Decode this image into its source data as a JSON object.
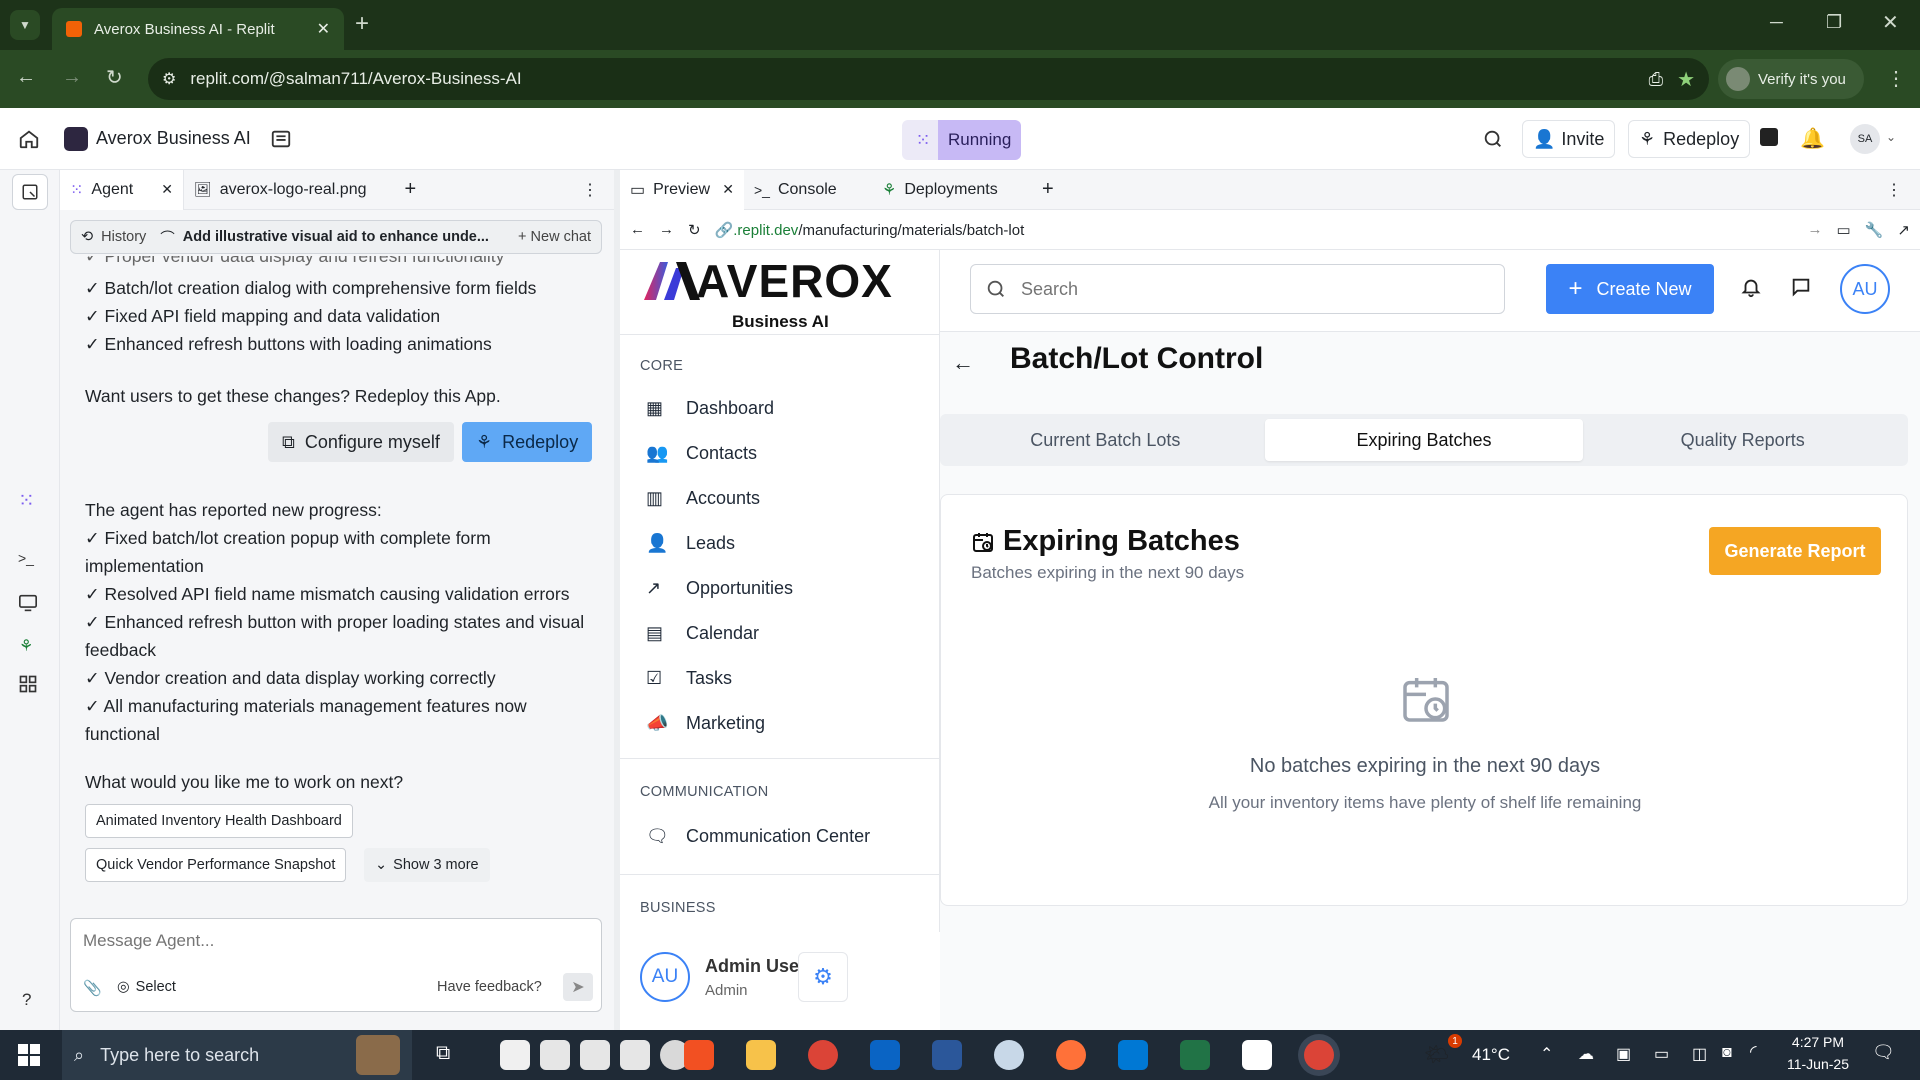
{
  "browser": {
    "tab_title": "Averox Business AI - Replit",
    "url": "replit.com/@salman711/Averox-Business-AI",
    "verify_label": "Verify it's you"
  },
  "replit": {
    "project_name": "Averox Business AI",
    "status": "Running",
    "invite_label": "Invite",
    "redeploy_label": "Redeploy",
    "avatar": "SA"
  },
  "agent": {
    "tabs": [
      "Agent",
      "averox-logo-real.png"
    ],
    "history_label": "History",
    "chat_title": "Add illustrative visual aid to enhance unde...",
    "new_chat_label": "New chat",
    "lines_top": [
      "✓ Proper vendor data display and refresh functionality",
      "✓ Batch/lot creation dialog with comprehensive form fields",
      "✓ Fixed API field mapping and data validation",
      "✓ Enhanced refresh buttons with loading animations"
    ],
    "redeploy_prompt": "Want users to get these changes? Redeploy this App.",
    "configure_label": "Configure myself",
    "redeploy_label": "Redeploy",
    "progress_header": "The agent has reported new progress:",
    "progress_lines": [
      "✓ Fixed batch/lot creation popup with complete form implementation",
      "✓ Resolved API field name mismatch causing validation errors",
      "✓ Enhanced refresh button with proper loading states and visual feedback",
      "✓ Vendor creation and data display working correctly",
      "✓ All manufacturing materials management features now functional"
    ],
    "question": "What would you like me to work on next?",
    "suggestions": [
      "Animated Inventory Health Dashboard",
      "Quick Vendor Performance Snapshot"
    ],
    "show_more": "Show 3 more",
    "input_placeholder": "Message Agent...",
    "select_label": "Select",
    "feedback_label": "Have feedback?"
  },
  "preview": {
    "tabs": [
      "Preview",
      "Console",
      "Deployments"
    ],
    "url_domain": ".replit.dev",
    "url_path": "/manufacturing/materials/batch-lot"
  },
  "app": {
    "logo_text": "AVEROX",
    "logo_sub": "Business AI",
    "search_placeholder": "Search",
    "create_new": "Create New",
    "user_initials": "AU",
    "sections": {
      "core": "CORE",
      "communication": "COMMUNICATION",
      "business": "BUSINESS"
    },
    "nav_core": [
      "Dashboard",
      "Contacts",
      "Accounts",
      "Leads",
      "Opportunities",
      "Calendar",
      "Tasks",
      "Marketing"
    ],
    "nav_comm": [
      "Communication Center"
    ],
    "user_name": "Admin User",
    "user_role": "Admin",
    "page_title": "Batch/Lot Control",
    "tabs": [
      "Current Batch Lots",
      "Expiring Batches",
      "Quality Reports"
    ],
    "active_tab": "Expiring Batches",
    "card_title": "Expiring Batches",
    "card_subtitle": "Batches expiring in the next 90 days",
    "generate_report": "Generate Report",
    "empty_title": "No batches expiring in the next 90 days",
    "empty_sub": "All your inventory items have plenty of shelf life remaining"
  },
  "taskbar": {
    "search_placeholder": "Type here to search",
    "temperature": "41°C",
    "time": "4:27 PM",
    "date": "11-Jun-25",
    "notif_count": "1"
  },
  "colors": {
    "chrome_dark": "#1d3319",
    "primary_blue": "#3b82f6",
    "orange": "#f5a623",
    "running_bg": "#c7b9f5"
  }
}
